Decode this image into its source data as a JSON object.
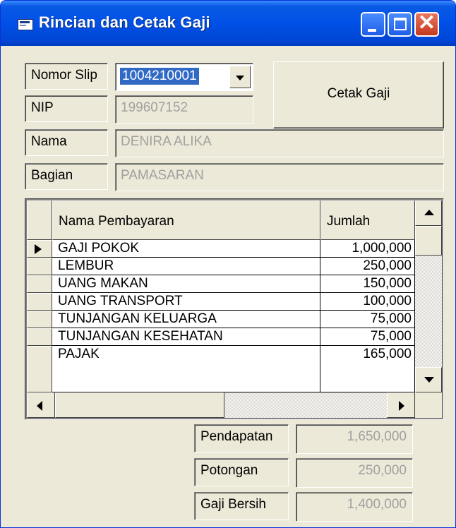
{
  "window": {
    "title": "Rincian dan Cetak Gaji",
    "close_glyph": "✕",
    "icons": [
      "app-form-icon",
      "minimize-icon",
      "maximize-icon",
      "close-icon"
    ]
  },
  "form": {
    "nomor_slip": {
      "label": "Nomor Slip",
      "value": "1004210001"
    },
    "nip": {
      "label": "NIP",
      "value": "199607152"
    },
    "nama": {
      "label": "Nama",
      "value": "DENIRA ALIKA"
    },
    "bagian": {
      "label": "Bagian",
      "value": "PAMASARAN"
    },
    "print_button": "Cetak Gaji"
  },
  "grid": {
    "columns": [
      "Nama Pembayaran",
      "Jumlah"
    ],
    "rows": [
      {
        "name": "GAJI POKOK",
        "amount": "1,000,000",
        "current": true
      },
      {
        "name": "LEMBUR",
        "amount": "250,000"
      },
      {
        "name": "UANG MAKAN",
        "amount": "150,000"
      },
      {
        "name": "UANG TRANSPORT",
        "amount": "100,000"
      },
      {
        "name": "TUNJANGAN KELUARGA",
        "amount": "75,000"
      },
      {
        "name": "TUNJANGAN KESEHATAN",
        "amount": "75,000"
      },
      {
        "name": "PAJAK",
        "amount": "165,000"
      }
    ]
  },
  "totals": {
    "pendapatan": {
      "label": "Pendapatan",
      "value": "1,650,000"
    },
    "potongan": {
      "label": "Potongan",
      "value": "250,000"
    },
    "gaji_bersih": {
      "label": "Gaji Bersih",
      "value": "1,400,000"
    }
  }
}
